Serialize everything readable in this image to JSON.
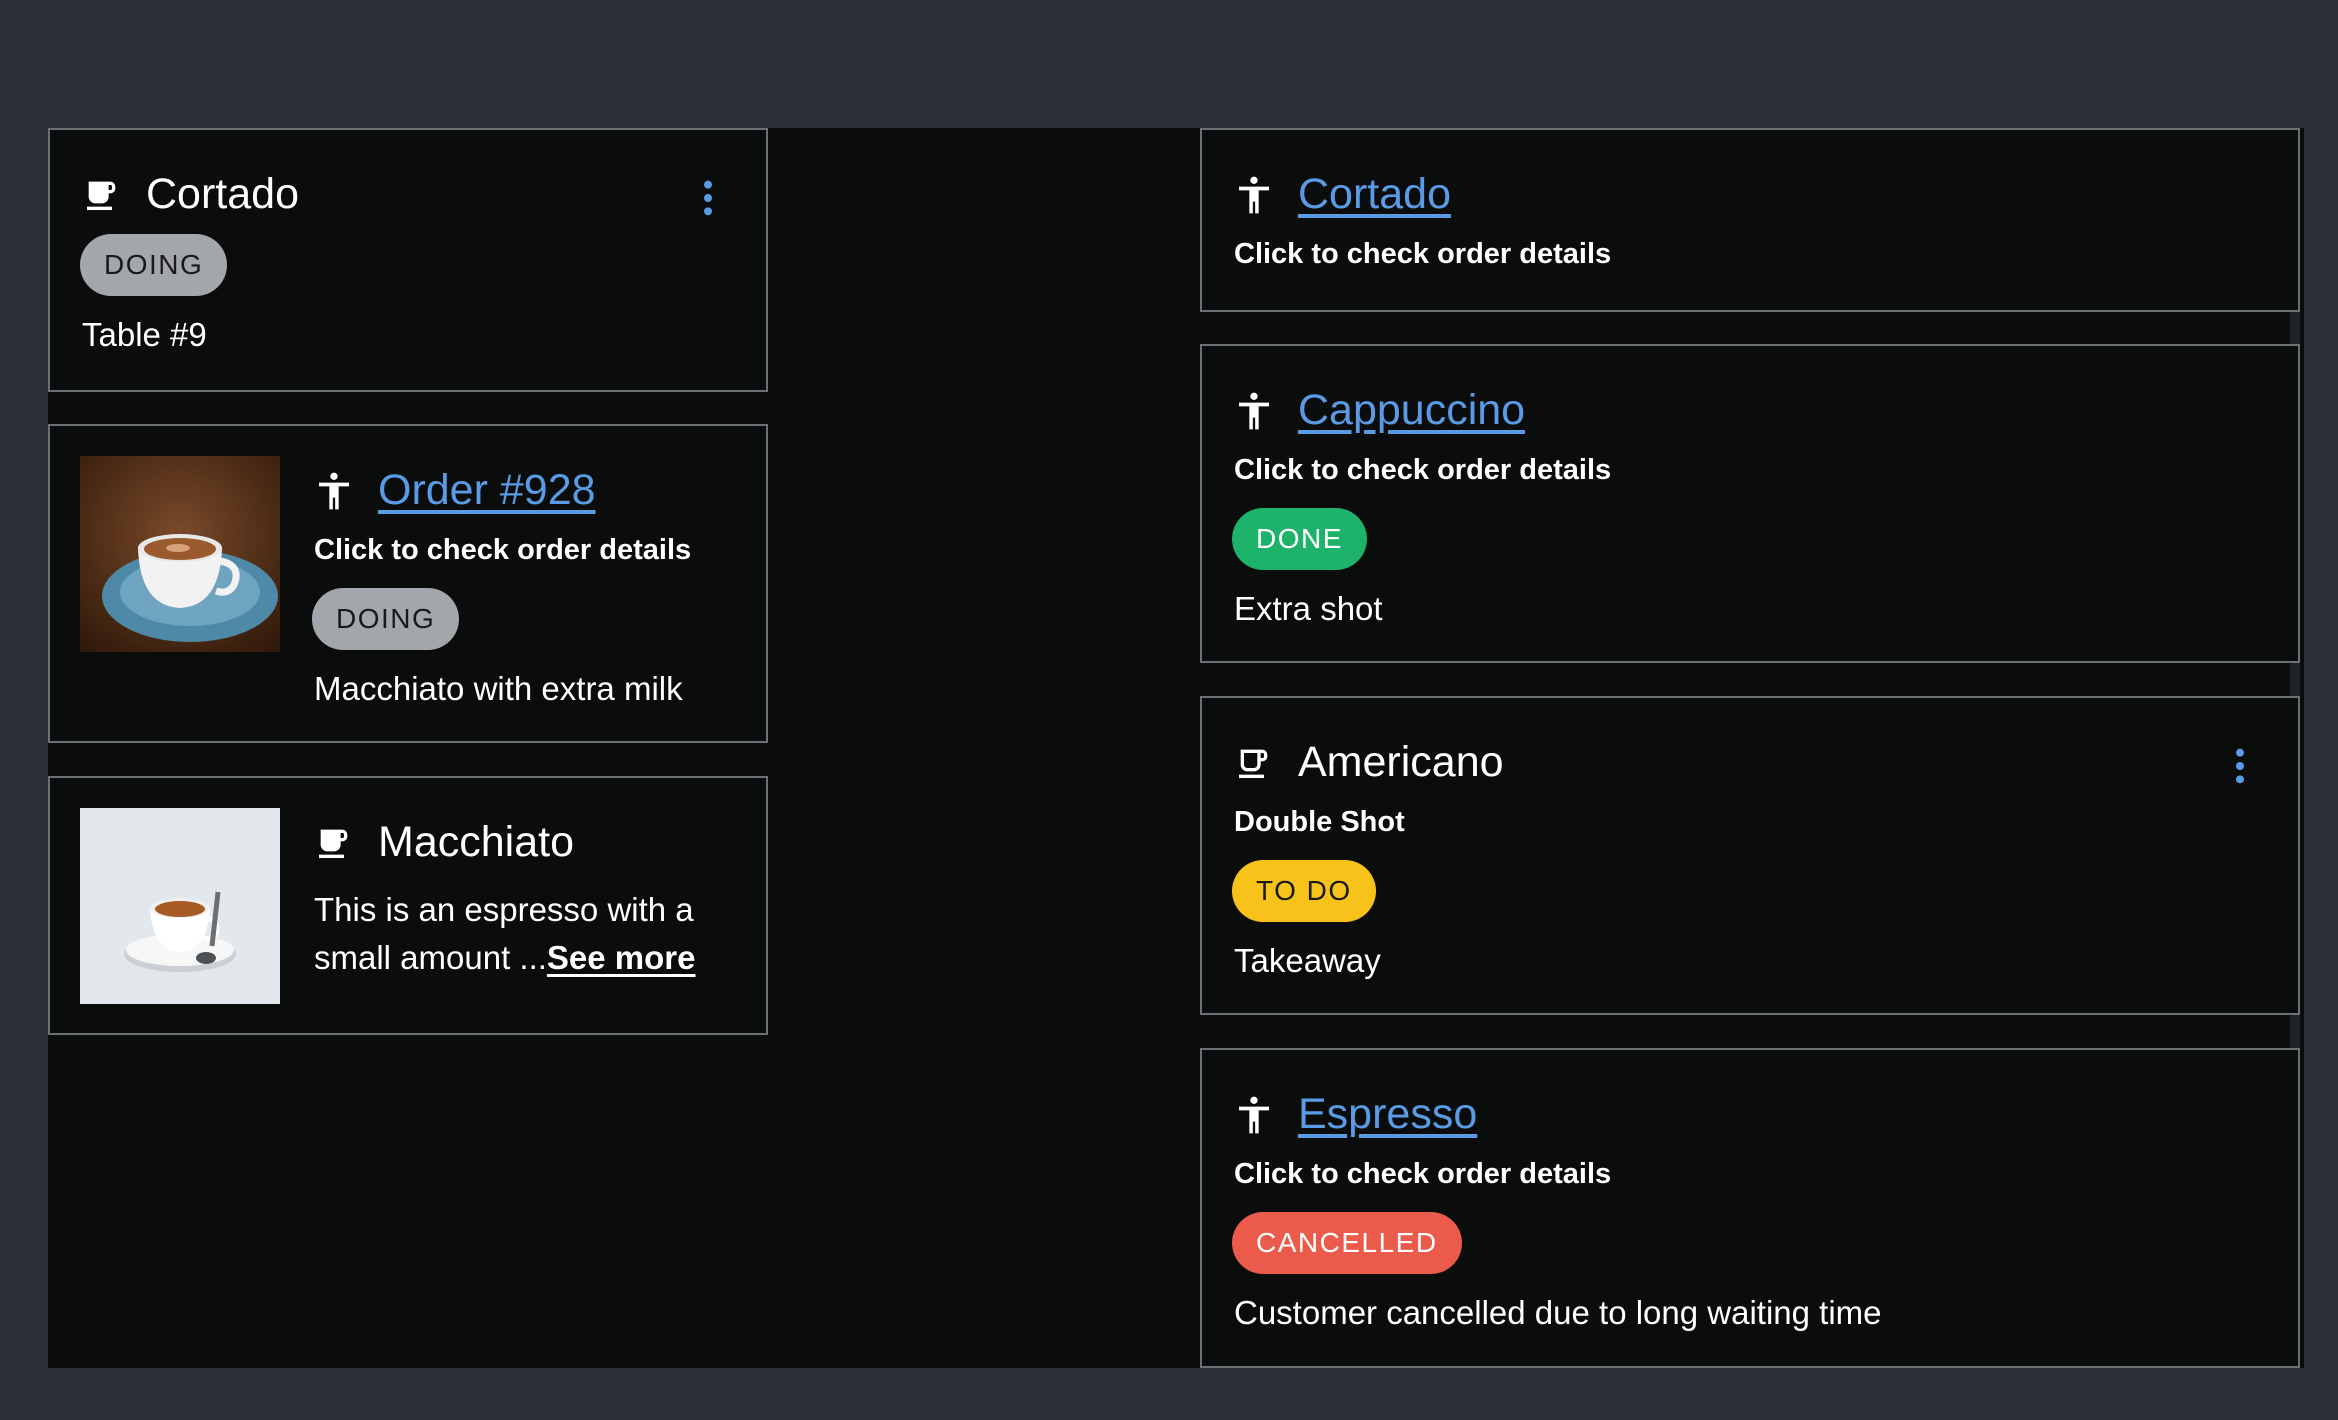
{
  "colors": {
    "page_bg": "#2d3036",
    "panel_bg": "#0b0c0c",
    "card_border": "#6b6f76",
    "link": "#5a9be6",
    "doing": "#a3a6ab",
    "done": "#1eb36b",
    "todo": "#f7c21a",
    "cancelled": "#ea5b4b"
  },
  "left_column": {
    "card1": {
      "icon": "coffee-cup-icon",
      "title": "Cortado",
      "status": "DOING",
      "note": "Table #9",
      "menu_icon": "more-vertical-icon"
    },
    "card2": {
      "image": "coffee-cup-on-saucer-photo",
      "icon": "accessibility-icon",
      "title": "Order #928",
      "subtitle": "Click to check order details",
      "status": "DOING",
      "note": "Macchiato with extra milk"
    },
    "card3": {
      "image": "espresso-cup-photo",
      "icon": "coffee-cup-icon",
      "title": "Macchiato",
      "desc_line1": "This is an espresso with a",
      "desc_line2": "small amount ...",
      "see_more": "See more"
    }
  },
  "right_column": {
    "card1": {
      "icon": "accessibility-icon",
      "title": "Cortado",
      "subtitle": "Click to check order details"
    },
    "card2": {
      "icon": "accessibility-icon",
      "title": "Cappuccino",
      "subtitle": "Click to check order details",
      "status": "DONE",
      "note": "Extra shot"
    },
    "card3": {
      "icon": "coffee-cup-outline-icon",
      "title": "Americano",
      "subtitle": "Double Shot",
      "status": "TO DO",
      "note": "Takeaway",
      "menu_icon": "more-vertical-icon"
    },
    "card4": {
      "icon": "accessibility-icon",
      "title": "Espresso",
      "subtitle": "Click to check order details",
      "status": "CANCELLED",
      "note": "Customer cancelled due to long waiting time"
    }
  }
}
